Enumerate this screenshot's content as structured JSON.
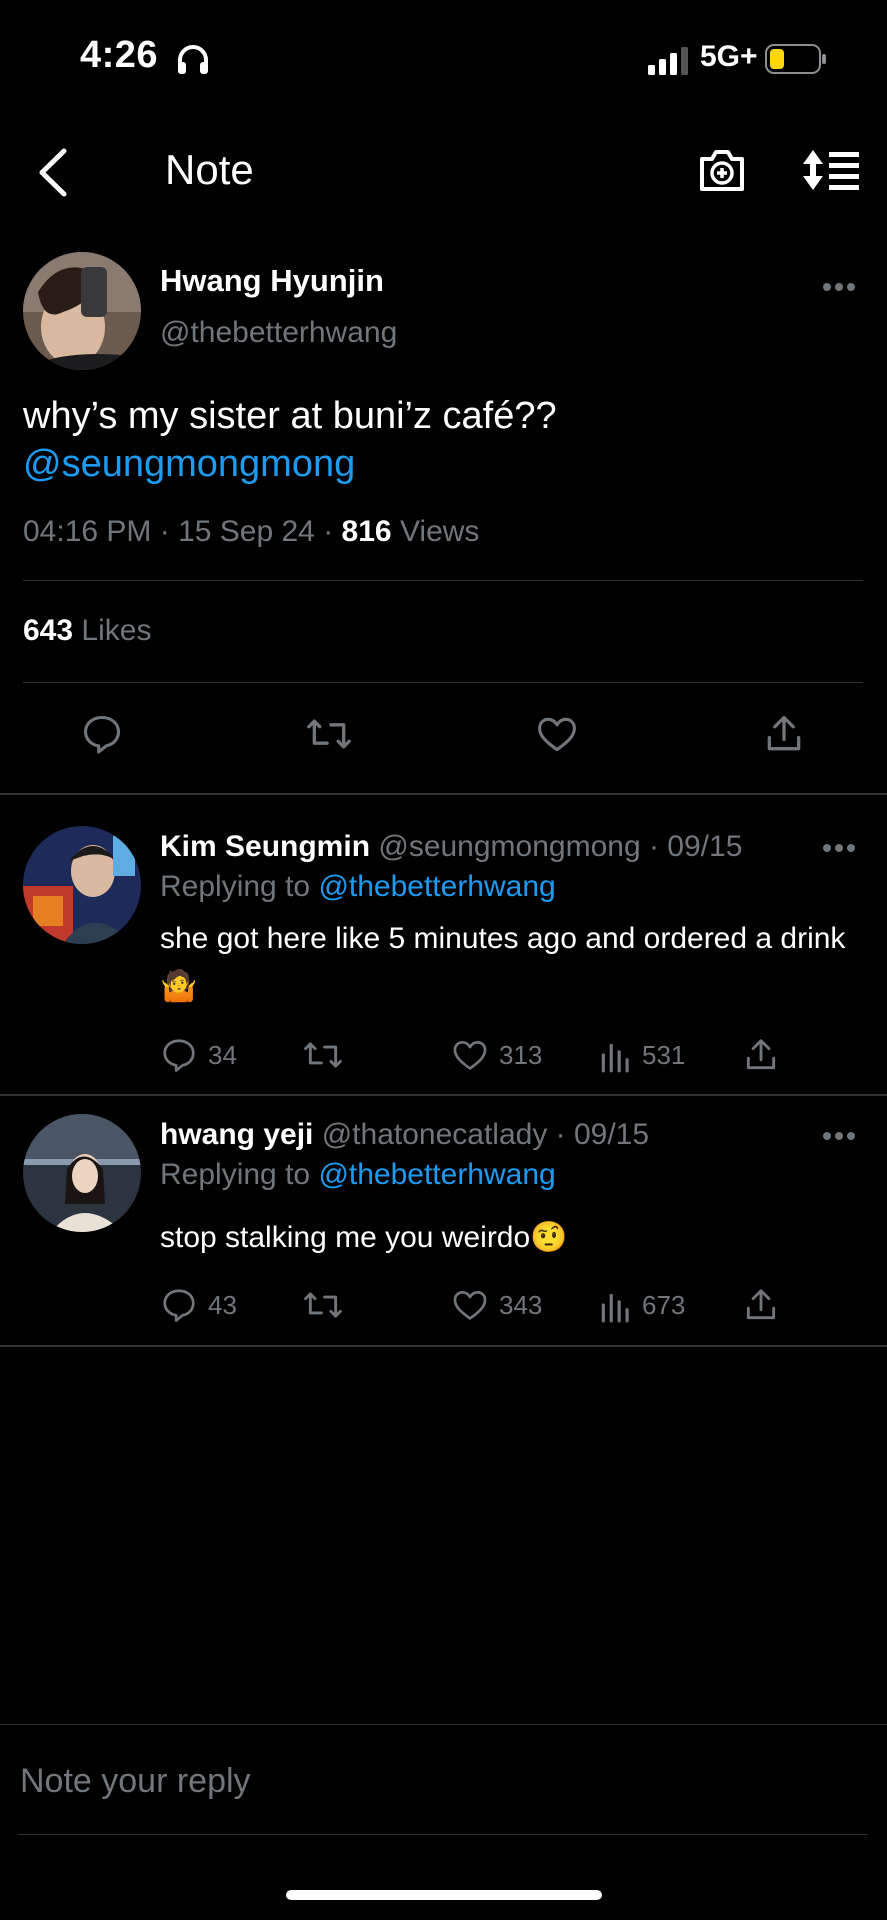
{
  "status_bar": {
    "time": "4:26",
    "network": "5G+",
    "battery_color": "#ffd60a"
  },
  "nav": {
    "title": "Note"
  },
  "post": {
    "author_name": "Hwang Hyunjin",
    "author_handle": "@thebetterhwang",
    "text": "why’s my sister at buni’z café??",
    "mention": "@seungmongmong",
    "time": "04:16 PM · 15 Sep 24 ·",
    "views_count": "816",
    "views_label": "Views",
    "likes_count": "643",
    "likes_label": "Likes"
  },
  "replies": [
    {
      "name": "Kim Seungmin",
      "handle_date": "@seungmongmong · 09/15",
      "replying_label": "Replying to",
      "replying_to": "@thebetterhwang",
      "text": "she got here like 5 minutes ago and ordered a drink🤷",
      "comments": "34",
      "likes": "313",
      "views": "531"
    },
    {
      "name": "hwang yeji",
      "handle_date": "@thatonecatlady · 09/15",
      "replying_label": "Replying to",
      "replying_to": "@thebetterhwang",
      "text": "stop stalking me you weirdo🤨",
      "comments": "43",
      "likes": "343",
      "views": "673"
    }
  ],
  "composer": {
    "placeholder": "Note your reply"
  },
  "colors": {
    "background": "#000000",
    "accent": "#1d9bf0",
    "muted": "#71767b",
    "divider": "#2f3336"
  }
}
